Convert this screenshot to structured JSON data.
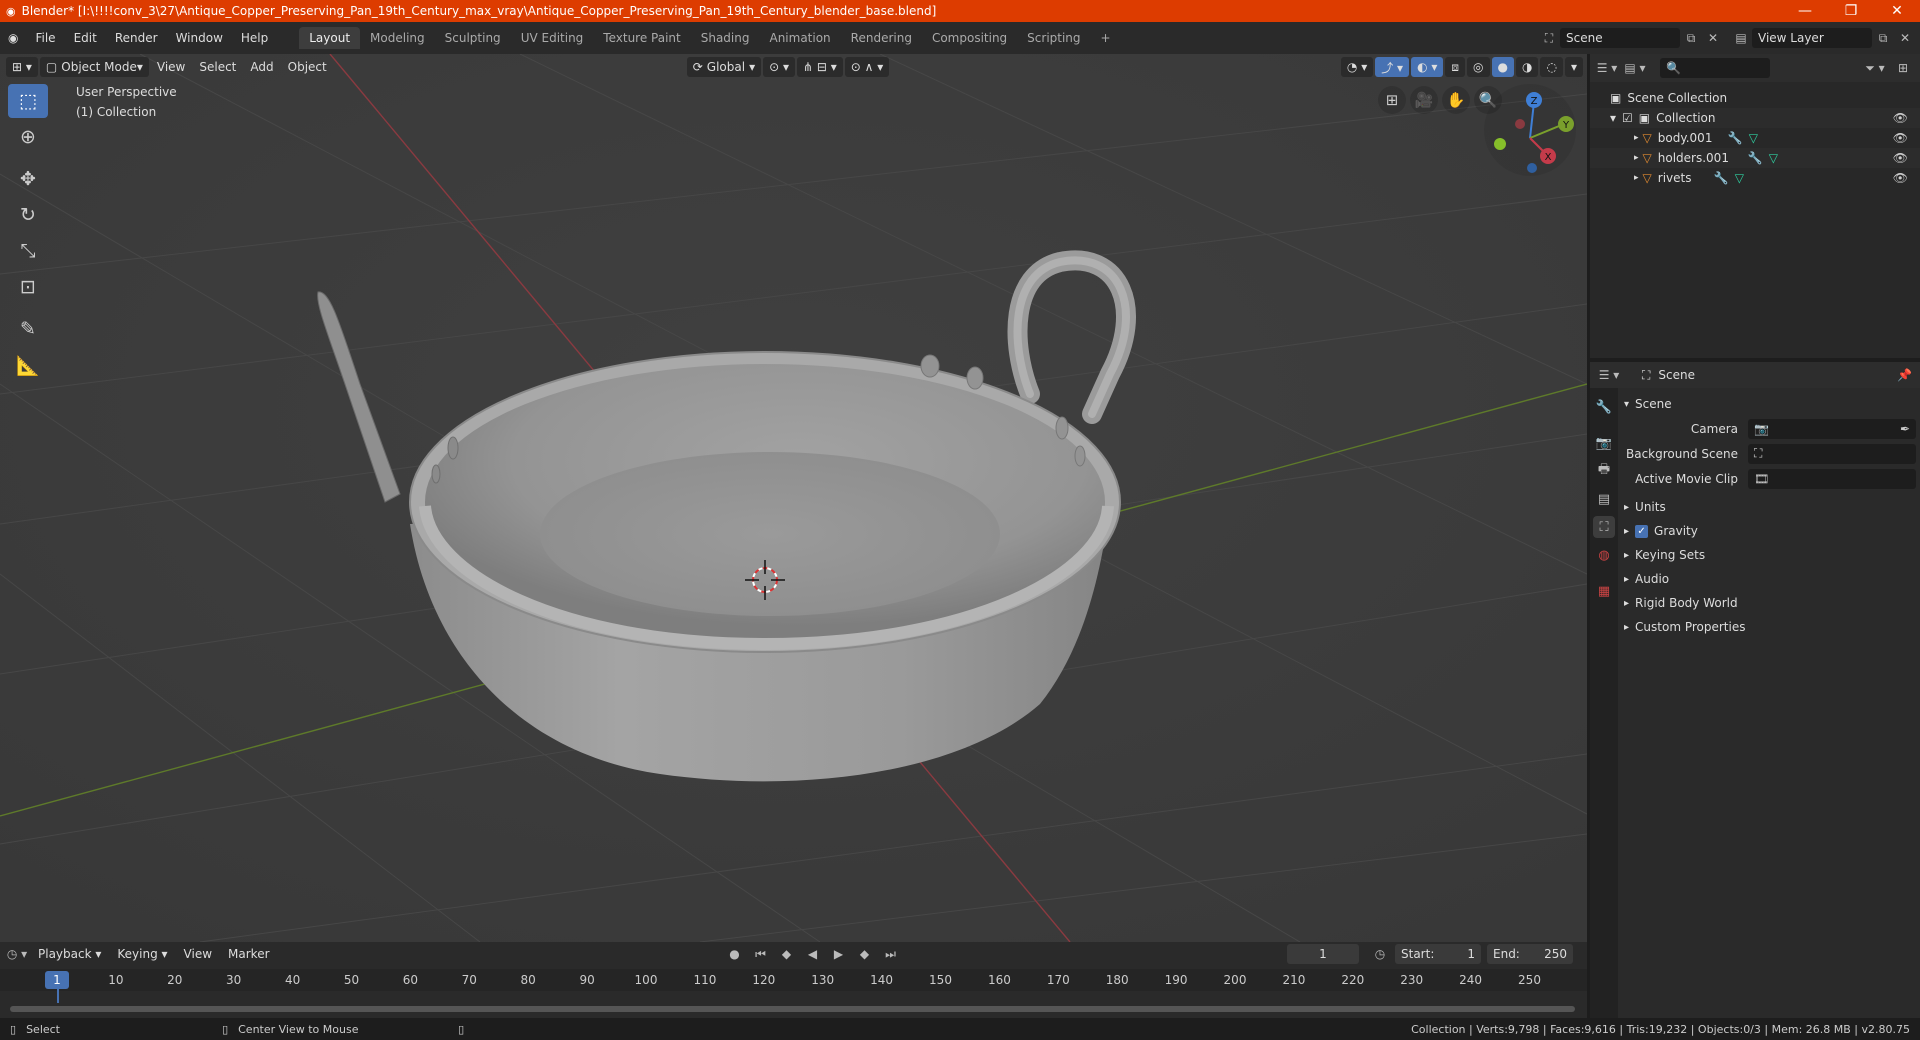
{
  "window": {
    "title": "Blender* [I:\\!!!!conv_3\\27\\Antique_Copper_Preserving_Pan_19th_Century_max_vray\\Antique_Copper_Preserving_Pan_19th_Century_blender_base.blend]"
  },
  "menus": [
    "File",
    "Edit",
    "Render",
    "Window",
    "Help"
  ],
  "workspace_tabs": [
    "Layout",
    "Modeling",
    "Sculpting",
    "UV Editing",
    "Texture Paint",
    "Shading",
    "Animation",
    "Rendering",
    "Compositing",
    "Scripting"
  ],
  "active_tab": "Layout",
  "scene_field": "Scene",
  "view_layer_field": "View Layer",
  "viewport": {
    "mode": "Object Mode",
    "menus": [
      "View",
      "Select",
      "Add",
      "Object"
    ],
    "transform_orientation": "Global",
    "info_line1": "User Perspective",
    "info_line2": "(1) Collection",
    "gizmo": {
      "x": "X",
      "y": "Y",
      "z": "Z"
    }
  },
  "tools": [
    "select-box-icon",
    "cursor-icon",
    "move-icon",
    "rotate-icon",
    "scale-icon",
    "transform-icon",
    "annotate-icon",
    "measure-icon"
  ],
  "outliner": {
    "root": "Scene Collection",
    "collection": "Collection",
    "objects": [
      "body.001",
      "holders.001",
      "rivets"
    ]
  },
  "properties": {
    "context": "Scene",
    "section": "Scene",
    "fields": [
      {
        "label": "Camera",
        "value": ""
      },
      {
        "label": "Background Scene",
        "value": ""
      },
      {
        "label": "Active Movie Clip",
        "value": ""
      }
    ],
    "panels": [
      "Units",
      "Gravity",
      "Keying Sets",
      "Audio",
      "Rigid Body World",
      "Custom Properties"
    ],
    "gravity_checked": true
  },
  "timeline": {
    "menus": [
      "Playback",
      "Keying",
      "View",
      "Marker"
    ],
    "current_frame": "1",
    "start_label": "Start:",
    "start": "1",
    "end_label": "End:",
    "end": "250",
    "ticks": [
      "1",
      "10",
      "20",
      "30",
      "40",
      "50",
      "60",
      "70",
      "80",
      "90",
      "100",
      "110",
      "120",
      "130",
      "140",
      "150",
      "160",
      "170",
      "180",
      "190",
      "200",
      "210",
      "220",
      "230",
      "240",
      "250"
    ]
  },
  "status": {
    "left": "Select",
    "middle": "Center View to Mouse",
    "right": "Collection | Verts:9,798 | Faces:9,616 | Tris:19,232 | Objects:0/3 | Mem: 26.8 MB | v2.80.75"
  },
  "colors": {
    "accent": "#4772b3",
    "titlebar": "#dd3c00",
    "x_axis": "#c43b4a",
    "y_axis": "#7aa02c",
    "z_axis": "#3f7fd6"
  }
}
